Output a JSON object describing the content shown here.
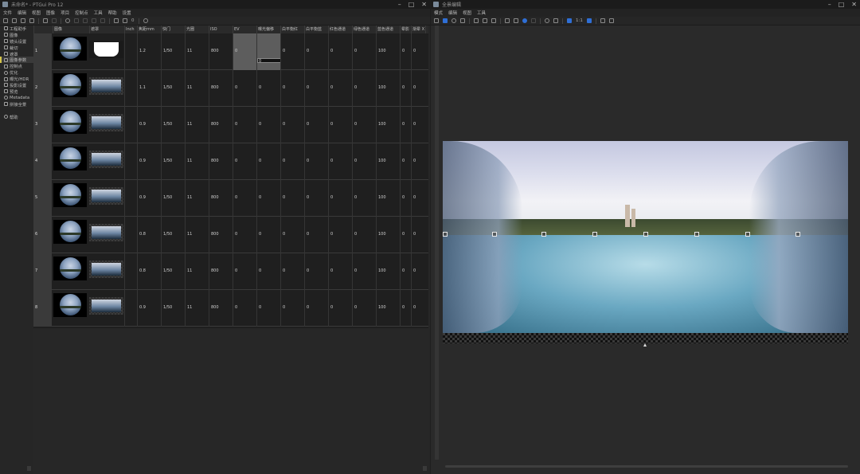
{
  "left_window": {
    "title": "未命名* - PTGui Pro 12",
    "menu": [
      "文件",
      "编辑",
      "视图",
      "图像",
      "项目",
      "控制点",
      "工具",
      "帮助",
      "设置"
    ],
    "toolbar_text": "0"
  },
  "sidebar": {
    "items": [
      {
        "label": "工程助手",
        "icon": "project-assistant-icon"
      },
      {
        "label": "图像",
        "icon": "images-icon"
      },
      {
        "label": "镜头设置",
        "icon": "lens-settings-icon"
      },
      {
        "label": "裁切",
        "icon": "crop-icon"
      },
      {
        "label": "遮罩",
        "icon": "mask-icon"
      },
      {
        "label": "图像参数",
        "icon": "image-parameters-icon"
      },
      {
        "label": "控制点",
        "icon": "control-points-icon"
      },
      {
        "label": "优化",
        "icon": "optimizer-icon"
      },
      {
        "label": "曝光/HDR",
        "icon": "exposure-hdr-icon"
      },
      {
        "label": "投影设置",
        "icon": "projection-settings-icon"
      },
      {
        "label": "预览",
        "icon": "preview-icon"
      },
      {
        "label": "Metadata",
        "icon": "metadata-icon"
      },
      {
        "label": "拼接全景",
        "icon": "create-panorama-icon"
      }
    ],
    "help": "帮助"
  },
  "table": {
    "headers": [
      "",
      "图像",
      "遮罩",
      "Inch",
      "焦距mm",
      "快门",
      "光圈",
      "ISO",
      "EV",
      "曝光偏移",
      "白平衡红",
      "白平衡蓝",
      "红色通道",
      "绿色通道",
      "蓝色通道",
      "晕影",
      "渐晕 X",
      ""
    ],
    "rows": [
      {
        "num": "1",
        "focal": "1.2",
        "shutter": "1/50",
        "aperture": "11",
        "iso": "800",
        "ev": "0",
        "offset": "0",
        "wb_r": "0",
        "wb_b": "0",
        "r": "0",
        "g": "0",
        "b": "100",
        "vig": "0",
        "vx": "0"
      },
      {
        "num": "2",
        "focal": "1.1",
        "shutter": "1/50",
        "aperture": "11",
        "iso": "800",
        "ev": "0",
        "offset": "0",
        "wb_r": "0",
        "wb_b": "0",
        "r": "0",
        "g": "0",
        "b": "100",
        "vig": "0",
        "vx": "0"
      },
      {
        "num": "3",
        "focal": "0.9",
        "shutter": "1/50",
        "aperture": "11",
        "iso": "800",
        "ev": "0",
        "offset": "0",
        "wb_r": "0",
        "wb_b": "0",
        "r": "0",
        "g": "0",
        "b": "100",
        "vig": "0",
        "vx": "0"
      },
      {
        "num": "4",
        "focal": "0.9",
        "shutter": "1/50",
        "aperture": "11",
        "iso": "800",
        "ev": "0",
        "offset": "0",
        "wb_r": "0",
        "wb_b": "0",
        "r": "0",
        "g": "0",
        "b": "100",
        "vig": "0",
        "vx": "0"
      },
      {
        "num": "5",
        "focal": "0.9",
        "shutter": "1/50",
        "aperture": "11",
        "iso": "800",
        "ev": "0",
        "offset": "0",
        "wb_r": "0",
        "wb_b": "0",
        "r": "0",
        "g": "0",
        "b": "100",
        "vig": "0",
        "vx": "0"
      },
      {
        "num": "6",
        "focal": "0.8",
        "shutter": "1/50",
        "aperture": "11",
        "iso": "800",
        "ev": "0",
        "offset": "0",
        "wb_r": "0",
        "wb_b": "0",
        "r": "0",
        "g": "0",
        "b": "100",
        "vig": "0",
        "vx": "0"
      },
      {
        "num": "7",
        "focal": "0.8",
        "shutter": "1/50",
        "aperture": "11",
        "iso": "800",
        "ev": "0",
        "offset": "0",
        "wb_r": "0",
        "wb_b": "0",
        "r": "0",
        "g": "0",
        "b": "100",
        "vig": "0",
        "vx": "0"
      },
      {
        "num": "8",
        "focal": "0.9",
        "shutter": "1/50",
        "aperture": "11",
        "iso": "800",
        "ev": "0",
        "offset": "0",
        "wb_r": "0",
        "wb_b": "0",
        "r": "0",
        "g": "0",
        "b": "100",
        "vig": "0",
        "vx": "0"
      }
    ]
  },
  "right_window": {
    "title": "全景编辑",
    "menu": [
      "模式",
      "编辑",
      "视图",
      "工具"
    ],
    "toolbar_text": "1:1"
  },
  "colors": {
    "accent": "#2f6fd6",
    "active_marker": "#d4c54a"
  }
}
